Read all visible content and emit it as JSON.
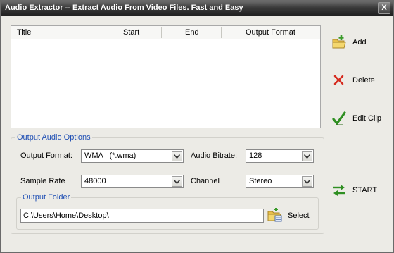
{
  "window": {
    "title": "Audio Extractor -- Extract Audio From Video Files.  Fast and Easy",
    "close_label": "X"
  },
  "list": {
    "columns": [
      "Title",
      "Start",
      "End",
      "Output Format"
    ]
  },
  "sidebar": {
    "add_label": "Add",
    "delete_label": "Delete",
    "edit_label": "Edit Clip",
    "start_label": "START"
  },
  "options": {
    "group_title": "Output Audio Options",
    "output_format_label": "Output Format:",
    "output_format_value": "WMA   (*.wma)",
    "audio_bitrate_label": "Audio Bitrate:",
    "audio_bitrate_value": "128",
    "sample_rate_label": "Sample Rate",
    "sample_rate_value": "48000",
    "channel_label": "Channel",
    "channel_value": "Stereo"
  },
  "folder": {
    "group_title": "Output Folder",
    "path": "C:\\Users\\Home\\Desktop\\",
    "select_label": "Select"
  },
  "colors": {
    "accent_blue": "#1f4fb4",
    "add_green": "#3a9b2a",
    "delete_red": "#d62b1f",
    "folder_yellow": "#e8c04a"
  },
  "icons": {
    "add": "folder-plus-icon",
    "delete": "x-icon",
    "edit": "checkmark-icon",
    "start": "swap-arrows-icon",
    "select": "folder-browse-icon"
  }
}
